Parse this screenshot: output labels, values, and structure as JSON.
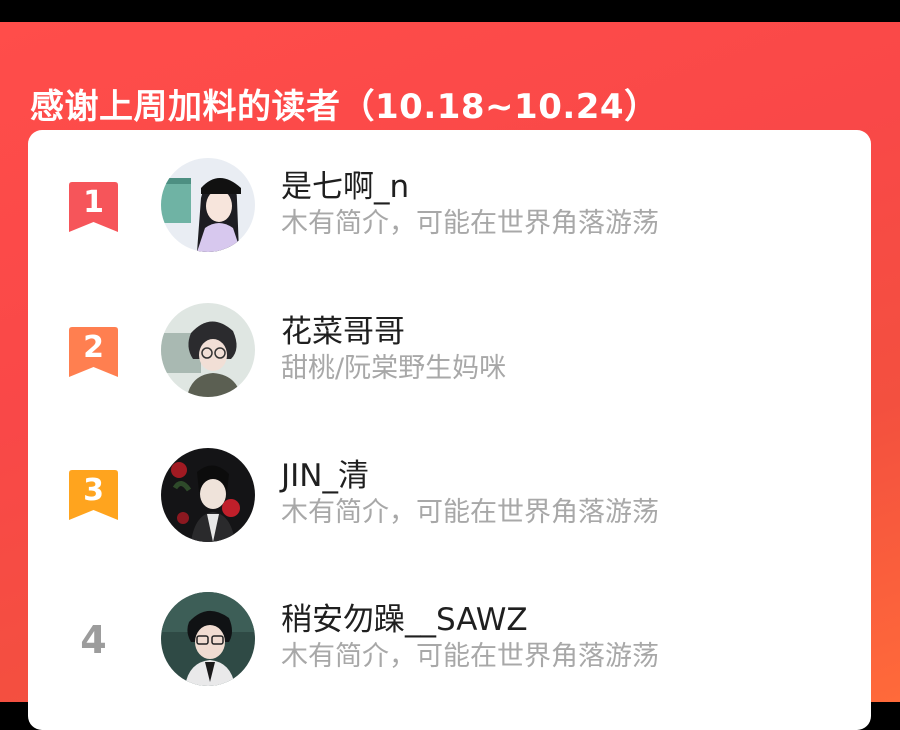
{
  "header": {
    "title": "感谢上周加料的读者（10.18~10.24）"
  },
  "colors": {
    "banner": "#f94848",
    "rank1": "#f6555a",
    "rank2": "#ff7f50",
    "rank3": "#ffa41e",
    "rank_plain": "#9c9c9c"
  },
  "readers": [
    {
      "rank": "1",
      "name": "是七啊_n",
      "desc": "木有简介，可能在世界角落游荡",
      "avatar_icon": "avatar-girl-cap"
    },
    {
      "rank": "2",
      "name": "花菜哥哥",
      "desc": "甜桃/阮棠野生妈咪",
      "avatar_icon": "avatar-boy-glasses"
    },
    {
      "rank": "3",
      "name": "JIN_清",
      "desc": "木有简介，可能在世界角落游荡",
      "avatar_icon": "avatar-man-roses"
    },
    {
      "rank": "4",
      "name": "稍安勿躁__SAWZ",
      "desc": "木有简介，可能在世界角落游荡",
      "avatar_icon": "avatar-man-glasses"
    }
  ]
}
